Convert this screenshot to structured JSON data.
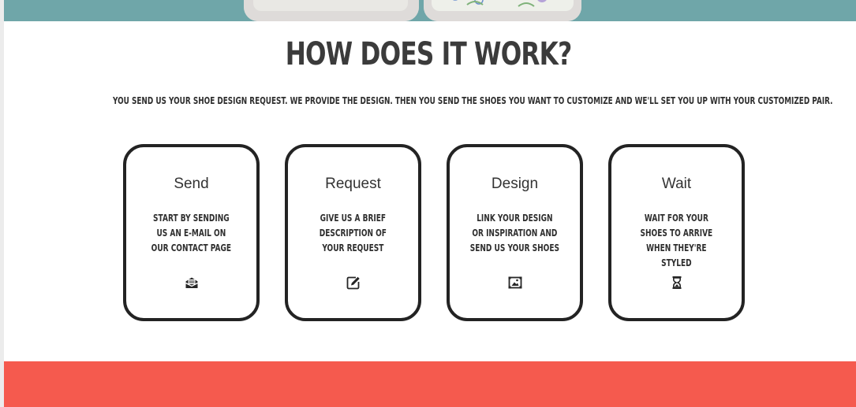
{
  "hero": {
    "image_alt": "Customized floral shoes"
  },
  "section": {
    "title": "HOW DOES IT WORK?",
    "subtitle": "YOU SEND US YOUR SHOE DESIGN REQUEST. WE PROVIDE THE DESIGN. THEN YOU SEND THE SHOES YOU WANT TO CUSTOMIZE AND WE'LL SET YOU UP WITH YOUR CUSTOMIZED PAIR."
  },
  "steps": [
    {
      "title": "Send",
      "text": "START BY SENDING\nUS AN E-MAIL ON\nOUR CONTACT PAGE",
      "icon": "envelope-open-icon"
    },
    {
      "title": "Request",
      "text": "GIVE US A BRIEF\nDESCRIPTION OF\nYOUR REQUEST",
      "icon": "edit-icon"
    },
    {
      "title": "Design",
      "text": "LINK YOUR DESIGN\nOR INSPIRATION AND\nSEND US YOUR SHOES",
      "icon": "image-icon"
    },
    {
      "title": "Wait",
      "text": "WAIT FOR YOUR\nSHOES TO ARRIVE\nWHEN THEY'RE\nSTYLED",
      "icon": "hourglass-icon"
    }
  ],
  "colors": {
    "hero_background": "#6fa6a9",
    "heading": "#3b3b3b",
    "card_border": "#232323",
    "footer_band": "#f55a4e"
  }
}
